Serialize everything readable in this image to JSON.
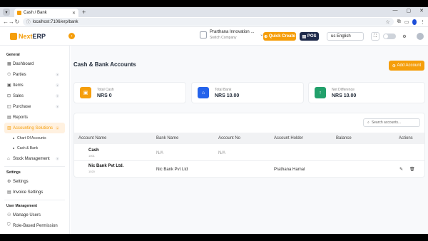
{
  "browser": {
    "tab_title": "Cash / Bank",
    "url": "localhost:7106/erp/bank"
  },
  "header": {
    "logo_part1": "Next",
    "logo_part2": "ERP",
    "company_name": "Prarthana Innovation ...",
    "company_sub": "Switch Company",
    "quick_create": "Quick Create",
    "pos": "POS",
    "language": "us English"
  },
  "sidebar": {
    "general": "General",
    "items": [
      {
        "label": "Dashboard",
        "icon": "grid-icon"
      },
      {
        "label": "Parties",
        "icon": "users-icon"
      },
      {
        "label": "Items",
        "icon": "box-icon"
      },
      {
        "label": "Sales",
        "icon": "cart-icon"
      },
      {
        "label": "Purchase",
        "icon": "bag-icon"
      },
      {
        "label": "Reports",
        "icon": "file-icon"
      },
      {
        "label": "Accounting Solutions",
        "icon": "calculator-icon"
      }
    ],
    "subitems": [
      "Chart Of Accounts",
      "Cash & Bank"
    ],
    "stock": "Stock Management",
    "settings_section": "Settings",
    "settings": "Settings",
    "invoice_settings": "Invoice Settings",
    "user_mgmt": "User Management",
    "manage_users": "Manage Users",
    "rbp": "Role-Based Permission"
  },
  "main": {
    "title": "Cash & Bank Accounts",
    "add_account": "Add Account",
    "cards": [
      {
        "label": "Total Cash",
        "value": "NRS 0",
        "color": "#f59e0b"
      },
      {
        "label": "Total Bank",
        "value": "NRS 10.00",
        "color": "#2563eb"
      },
      {
        "label": "Net Difference",
        "value": "NRS 10.00",
        "color": "#22a06b"
      }
    ],
    "search_placeholder": "Search accounts...",
    "columns": [
      "Account Name",
      "Bank Name",
      "Account No",
      "Account Holder",
      "Balance",
      "Actions"
    ],
    "rows": [
      {
        "name": "Cash",
        "code": "1001",
        "bank": "N/A",
        "account_no": "N/A",
        "holder": "",
        "balance": ""
      },
      {
        "name": "Nic Bank Pvt Ltd.",
        "code": "1020",
        "bank": "Nic Bank Pvt Ltd",
        "account_no": "",
        "holder": "Prathana Hamal",
        "balance": ""
      }
    ]
  }
}
